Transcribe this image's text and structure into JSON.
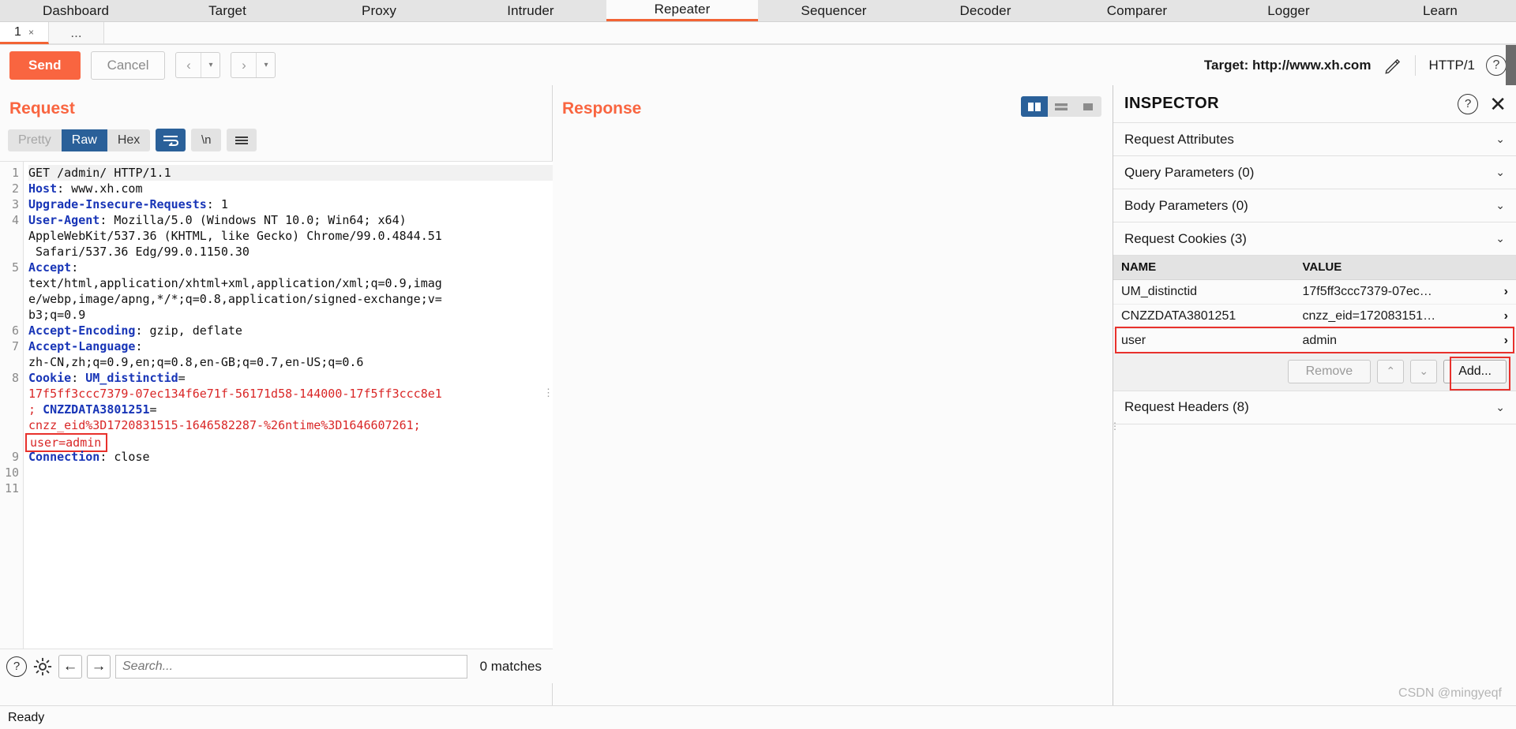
{
  "app": {
    "main_tabs": [
      {
        "label": "Dashboard",
        "active": false
      },
      {
        "label": "Target",
        "active": false
      },
      {
        "label": "Proxy",
        "active": false
      },
      {
        "label": "Intruder",
        "active": false
      },
      {
        "label": "Repeater",
        "active": true
      },
      {
        "label": "Sequencer",
        "active": false
      },
      {
        "label": "Decoder",
        "active": false
      },
      {
        "label": "Comparer",
        "active": false
      },
      {
        "label": "Logger",
        "active": false
      },
      {
        "label": "Learn",
        "active": false
      }
    ],
    "repeater_tabs": {
      "active_tab_label": "1",
      "close_glyph": "×",
      "new_tab_label": "..."
    }
  },
  "toolbar": {
    "send_label": "Send",
    "cancel_label": "Cancel",
    "back_glyph": "‹",
    "forward_glyph": "›",
    "caret_glyph": "▾",
    "target_label": "Target: http://www.xh.com",
    "edit_icon": "pencil-icon",
    "http_version": "HTTP/1",
    "help_glyph": "?"
  },
  "request": {
    "title": "Request",
    "format_tabs": [
      {
        "label": "Pretty",
        "state": "dim"
      },
      {
        "label": "Raw",
        "state": "active"
      },
      {
        "label": "Hex",
        "state": "normal"
      }
    ],
    "wrap_icon": "word-wrap-icon",
    "newline_label": "\\n",
    "menu_icon": "hamburger-menu-icon",
    "lines": [
      {
        "num": "1",
        "highlight": true,
        "segments": [
          {
            "t": "GET /admin/ HTTP/1.1",
            "c": "plain"
          }
        ]
      },
      {
        "num": "2",
        "highlight": false,
        "segments": [
          {
            "t": "Host",
            "c": "hdr"
          },
          {
            "t": ": www.xh.com",
            "c": "plain"
          }
        ]
      },
      {
        "num": "3",
        "highlight": false,
        "segments": [
          {
            "t": "Upgrade-Insecure-Requests",
            "c": "hdr"
          },
          {
            "t": ": 1",
            "c": "plain"
          }
        ]
      },
      {
        "num": "4",
        "highlight": false,
        "segments": [
          {
            "t": "User-Agent",
            "c": "hdr"
          },
          {
            "t": ": Mozilla/5.0 (Windows NT 10.0; Win64; x64)",
            "c": "plain"
          }
        ]
      },
      {
        "num": "",
        "highlight": false,
        "segments": [
          {
            "t": "AppleWebKit/537.36 (KHTML, like Gecko) Chrome/99.0.4844.51",
            "c": "plain"
          }
        ]
      },
      {
        "num": "",
        "highlight": false,
        "segments": [
          {
            "t": " Safari/537.36 Edg/99.0.1150.30",
            "c": "plain"
          }
        ]
      },
      {
        "num": "5",
        "highlight": false,
        "segments": [
          {
            "t": "Accept",
            "c": "hdr"
          },
          {
            "t": ":",
            "c": "plain"
          }
        ]
      },
      {
        "num": "",
        "highlight": false,
        "segments": [
          {
            "t": "text/html,application/xhtml+xml,application/xml;q=0.9,imag",
            "c": "plain"
          }
        ]
      },
      {
        "num": "",
        "highlight": false,
        "segments": [
          {
            "t": "e/webp,image/apng,*/*;q=0.8,application/signed-exchange;v=",
            "c": "plain"
          }
        ]
      },
      {
        "num": "",
        "highlight": false,
        "segments": [
          {
            "t": "b3;q=0.9",
            "c": "plain"
          }
        ]
      },
      {
        "num": "6",
        "highlight": false,
        "segments": [
          {
            "t": "Accept-Encoding",
            "c": "hdr"
          },
          {
            "t": ": gzip, deflate",
            "c": "plain"
          }
        ]
      },
      {
        "num": "7",
        "highlight": false,
        "segments": [
          {
            "t": "Accept-Language",
            "c": "hdr"
          },
          {
            "t": ":",
            "c": "plain"
          }
        ]
      },
      {
        "num": "",
        "highlight": false,
        "segments": [
          {
            "t": "zh-CN,zh;q=0.9,en;q=0.8,en-GB;q=0.7,en-US;q=0.6",
            "c": "plain"
          }
        ]
      },
      {
        "num": "8",
        "highlight": false,
        "segments": [
          {
            "t": "Cookie",
            "c": "hdr"
          },
          {
            "t": ": ",
            "c": "plain"
          },
          {
            "t": "UM_distinctid",
            "c": "ckey"
          },
          {
            "t": "=",
            "c": "plain"
          }
        ]
      },
      {
        "num": "",
        "highlight": false,
        "segments": [
          {
            "t": "17f5ff3ccc7379-07ec134f6e71f-56171d58-144000-17f5ff3ccc8e1",
            "c": "cval"
          }
        ]
      },
      {
        "num": "",
        "highlight": false,
        "segments": [
          {
            "t": "; ",
            "c": "cval"
          },
          {
            "t": "CNZZDATA3801251",
            "c": "ckey"
          },
          {
            "t": "=",
            "c": "plain"
          }
        ]
      },
      {
        "num": "",
        "highlight": false,
        "segments": [
          {
            "t": "cnzz_eid%3D1720831515-1646582287-%26ntime%3D1646607261;",
            "c": "cval"
          }
        ]
      },
      {
        "num": "",
        "highlight": false,
        "segments": [
          {
            "t": "user=admin",
            "c": "boxed"
          }
        ]
      },
      {
        "num": "9",
        "highlight": false,
        "segments": [
          {
            "t": "Connection",
            "c": "hdr"
          },
          {
            "t": ": close",
            "c": "plain"
          }
        ]
      },
      {
        "num": "10",
        "highlight": false,
        "segments": []
      },
      {
        "num": "11",
        "highlight": false,
        "segments": []
      }
    ],
    "search": {
      "help_glyph": "?",
      "settings_icon": "gear-icon",
      "prev_glyph": "←",
      "next_glyph": "→",
      "placeholder": "Search...",
      "value": "",
      "matches_label": "0 matches"
    }
  },
  "response": {
    "title": "Response",
    "view_buttons": [
      {
        "icon": "split-vertical-view-icon",
        "active": true
      },
      {
        "icon": "split-horizontal-view-icon",
        "active": false
      },
      {
        "icon": "single-view-icon",
        "active": false
      }
    ]
  },
  "inspector": {
    "title": "INSPECTOR",
    "help_glyph": "?",
    "close_glyph": "✕",
    "sections": [
      {
        "label": "Request Attributes",
        "chevron": "⌄",
        "expanded": false
      },
      {
        "label": "Query Parameters (0)",
        "chevron": "⌄",
        "expanded": false
      },
      {
        "label": "Body Parameters (0)",
        "chevron": "⌄",
        "expanded": false
      }
    ],
    "cookies_section": {
      "label": "Request Cookies (3)",
      "chevron": "⌄",
      "columns": [
        "NAME",
        "VALUE"
      ],
      "rows": [
        {
          "name": "UM_distinctid",
          "value": "17f5ff3ccc7379-07ec…",
          "arrow": "›",
          "highlighted": false
        },
        {
          "name": "CNZZDATA3801251",
          "value": "cnzz_eid=172083151…",
          "arrow": "›",
          "highlighted": false
        },
        {
          "name": "user",
          "value": "admin",
          "arrow": "›",
          "highlighted": true
        }
      ],
      "actions": {
        "remove_label": "Remove",
        "up_glyph": "⌃",
        "down_glyph": "⌄",
        "add_label": "Add...",
        "add_highlighted": true
      }
    },
    "headers_section": {
      "label": "Request Headers (8)",
      "chevron": "⌄"
    }
  },
  "status": {
    "text": "Ready",
    "watermark": "CSDN @mingyeqf"
  },
  "colors": {
    "accent_orange": "#f96540",
    "tab_underline": "#f26334",
    "selected_blue": "#2a6099",
    "header_blue": "#1835b7",
    "cookie_red": "#d92626",
    "highlight_box_red": "#e8312c"
  }
}
